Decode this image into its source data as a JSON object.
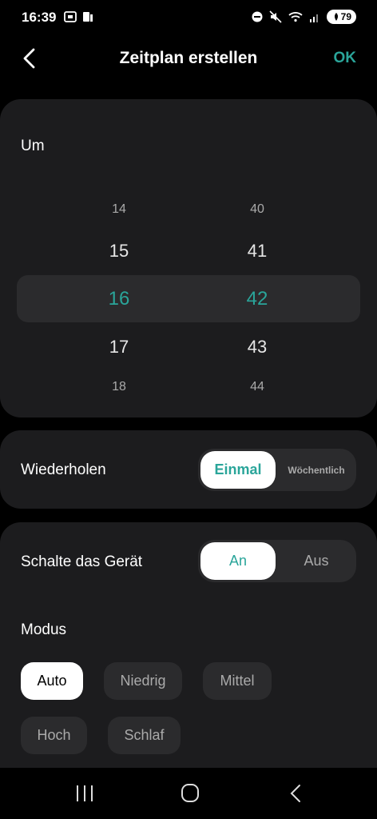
{
  "status_bar": {
    "time": "16:39",
    "battery": "79"
  },
  "header": {
    "title": "Zeitplan erstellen",
    "ok_label": "OK"
  },
  "time_picker": {
    "label": "Um",
    "hours": [
      "14",
      "15",
      "16",
      "17",
      "18"
    ],
    "minutes": [
      "40",
      "41",
      "42",
      "43",
      "44"
    ],
    "selected_hour": "16",
    "selected_minute": "42"
  },
  "repeat": {
    "label": "Wiederholen",
    "option_once": "Einmal",
    "option_weekly": "Wöchentlich",
    "selected": "Einmal"
  },
  "switch": {
    "label": "Schalte das Gerät",
    "option_on": "An",
    "option_off": "Aus",
    "selected": "An"
  },
  "mode": {
    "label": "Modus",
    "options": [
      "Auto",
      "Niedrig",
      "Mittel",
      "Hoch",
      "Schlaf"
    ],
    "selected": "Auto"
  },
  "colors": {
    "accent": "#2aa59a",
    "card": "#1c1c1e",
    "background": "#000000"
  }
}
